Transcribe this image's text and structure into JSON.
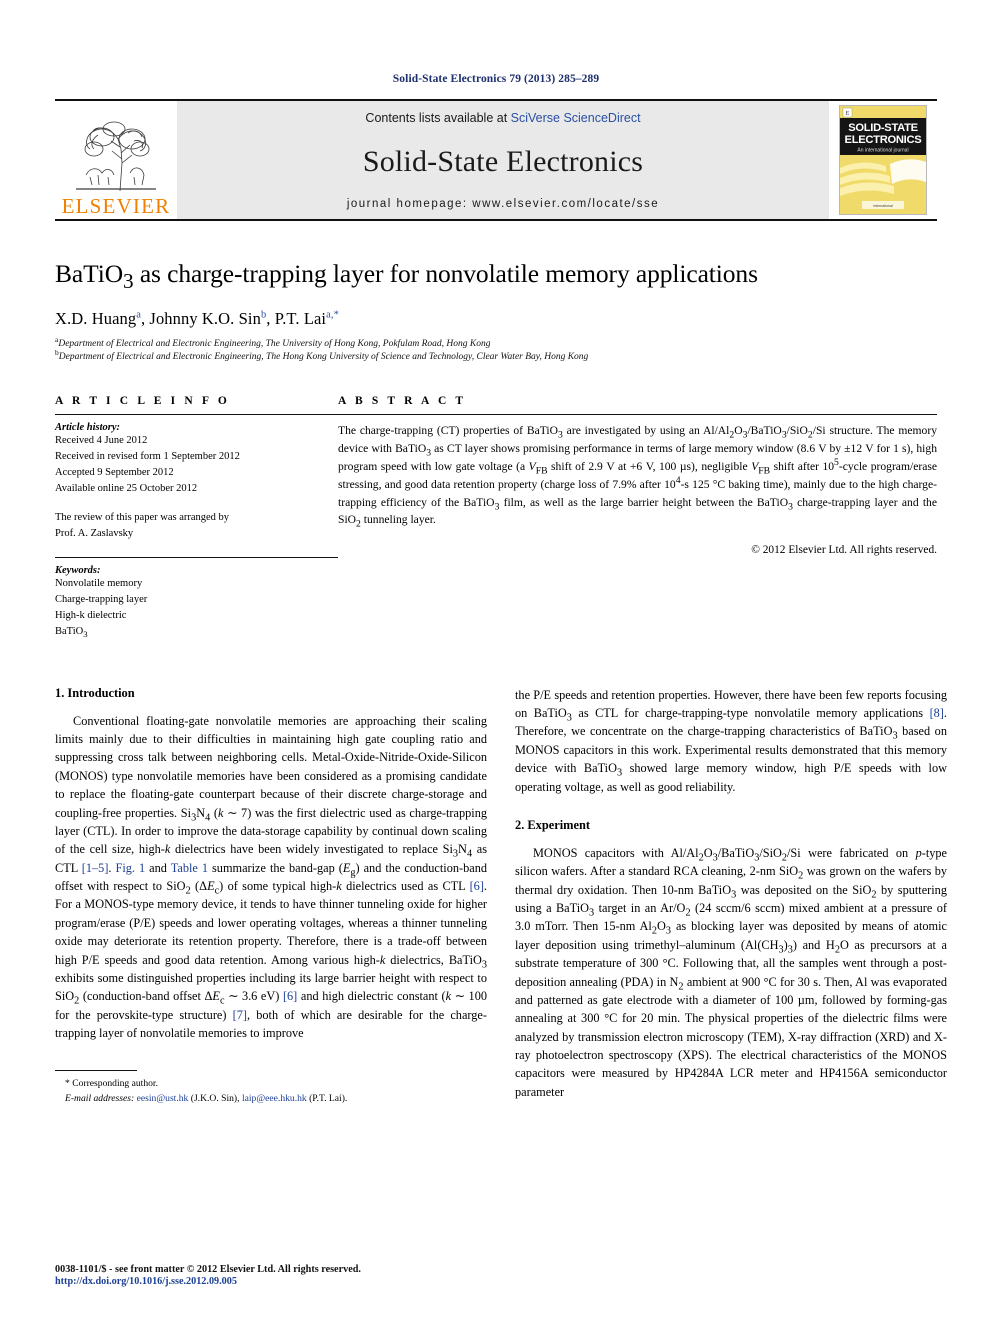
{
  "running_head": "Solid-State Electronics 79 (2013) 285–289",
  "masthead": {
    "publisher_name": "ELSEVIER",
    "contents_prefix": "Contents lists available at ",
    "contents_link": "SciVerse ScienceDirect",
    "journal_title": "Solid-State Electronics",
    "homepage": "journal homepage: www.elsevier.com/locate/sse",
    "cover": {
      "line1": "SOLID-STATE",
      "line2": "ELECTRONICS",
      "line3": "An international journal",
      "footer": "international"
    },
    "link_color": "#2a4fa2"
  },
  "article": {
    "title_parts": {
      "pre": "BaTiO",
      "sub": "3",
      "post": " as charge-trapping layer for nonvolatile memory applications"
    },
    "authors": [
      {
        "name": "X.D. Huang",
        "marks": "a",
        "sep": ", "
      },
      {
        "name": "Johnny K.O. Sin",
        "marks": "b",
        "sep": ", "
      },
      {
        "name": "P.T. Lai",
        "marks": "a,*",
        "sep": ""
      }
    ],
    "affiliations": [
      {
        "mark": "a",
        "text": "Department of Electrical and Electronic Engineering, The University of Hong Kong, Pokfulam Road, Hong Kong"
      },
      {
        "mark": "b",
        "text": "Department of Electrical and Electronic Engineering, The Hong Kong University of Science and Technology, Clear Water Bay, Hong Kong"
      }
    ]
  },
  "article_info": {
    "heading": "A R T I C L E    I N F O",
    "history_label": "Article history:",
    "history": [
      "Received 4 June 2012",
      "Received in revised form 1 September 2012",
      "Accepted 9 September 2012",
      "Available online 25 October 2012"
    ],
    "review_note_line1": "The review of this paper was arranged by",
    "review_note_line2": "Prof. A. Zaslavsky",
    "keywords_label": "Keywords:",
    "keywords": [
      "Nonvolatile memory",
      "Charge-trapping layer",
      "High-k dielectric",
      "BaTiO3"
    ]
  },
  "abstract": {
    "heading": "A B S T R A C T",
    "copyright": "© 2012 Elsevier Ltd. All rights reserved."
  },
  "sections": {
    "introduction_heading": "1. Introduction",
    "experiment_heading": "2. Experiment"
  },
  "footnote": {
    "corresponding": "* Corresponding author.",
    "email_label": "E-mail addresses:",
    "email1": "eesin@ust.hk",
    "email1_owner": " (J.K.O. Sin), ",
    "email2": "laip@eee.hku.hk",
    "email2_owner": " (P.T. Lai)."
  },
  "page_footer": {
    "line1": "0038-1101/$ - see front matter © 2012 Elsevier Ltd. All rights reserved.",
    "line2": "http://dx.doi.org/10.1016/j.sse.2012.09.005"
  }
}
